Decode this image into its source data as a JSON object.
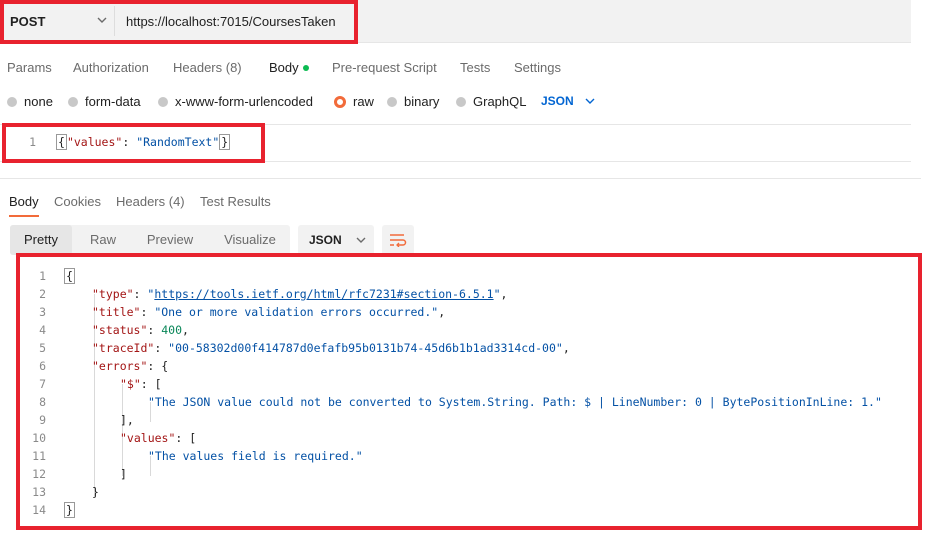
{
  "request": {
    "method": "POST",
    "url": "https://localhost:7015/CoursesTaken"
  },
  "request_tabs": [
    {
      "label": "Params"
    },
    {
      "label": "Authorization"
    },
    {
      "label": "Headers (8)"
    },
    {
      "label": "Body"
    },
    {
      "label": "Pre-request Script"
    },
    {
      "label": "Tests"
    },
    {
      "label": "Settings"
    }
  ],
  "body_types": [
    {
      "label": "none"
    },
    {
      "label": "form-data"
    },
    {
      "label": "x-www-form-urlencoded"
    },
    {
      "label": "raw",
      "selected": true
    },
    {
      "label": "binary"
    },
    {
      "label": "GraphQL"
    }
  ],
  "body_language": "JSON",
  "request_body": {
    "line_number": "1",
    "key": "\"values\"",
    "colon": ": ",
    "value": "\"RandomText\""
  },
  "response_tabs": [
    {
      "label": "Body"
    },
    {
      "label": "Cookies"
    },
    {
      "label": "Headers (4)"
    },
    {
      "label": "Test Results"
    }
  ],
  "view_modes": [
    {
      "label": "Pretty"
    },
    {
      "label": "Raw"
    },
    {
      "label": "Preview"
    },
    {
      "label": "Visualize"
    }
  ],
  "response_format": "JSON",
  "response_lines": [
    {
      "n": "1",
      "indent": 0,
      "parts": [
        [
          "p",
          "{"
        ]
      ]
    },
    {
      "n": "2",
      "indent": 1,
      "parts": [
        [
          "k",
          "\"type\""
        ],
        [
          "p",
          ": "
        ],
        [
          "q",
          "\""
        ],
        [
          "l",
          "https://tools.ietf.org/html/rfc7231#section-6.5.1"
        ],
        [
          "q",
          "\""
        ],
        [
          "p",
          ","
        ]
      ]
    },
    {
      "n": "3",
      "indent": 1,
      "parts": [
        [
          "k",
          "\"title\""
        ],
        [
          "p",
          ": "
        ],
        [
          "s",
          "\"One or more validation errors occurred.\""
        ],
        [
          "p",
          ","
        ]
      ]
    },
    {
      "n": "4",
      "indent": 1,
      "parts": [
        [
          "k",
          "\"status\""
        ],
        [
          "p",
          ": "
        ],
        [
          "n",
          "400"
        ],
        [
          "p",
          ","
        ]
      ]
    },
    {
      "n": "5",
      "indent": 1,
      "parts": [
        [
          "k",
          "\"traceId\""
        ],
        [
          "p",
          ": "
        ],
        [
          "s",
          "\"00-58302d00f414787d0efafb95b0131b74-45d6b1b1ad3314cd-00\""
        ],
        [
          "p",
          ","
        ]
      ]
    },
    {
      "n": "6",
      "indent": 1,
      "parts": [
        [
          "k",
          "\"errors\""
        ],
        [
          "p",
          ": {"
        ]
      ]
    },
    {
      "n": "7",
      "indent": 2,
      "parts": [
        [
          "k",
          "\"$\""
        ],
        [
          "p",
          ": ["
        ]
      ]
    },
    {
      "n": "8",
      "indent": 3,
      "parts": [
        [
          "s",
          "\"The JSON value could not be converted to System.String. Path: $ | LineNumber: 0 | BytePositionInLine: 1.\""
        ]
      ]
    },
    {
      "n": "9",
      "indent": 2,
      "parts": [
        [
          "p",
          "],"
        ]
      ]
    },
    {
      "n": "10",
      "indent": 2,
      "parts": [
        [
          "k",
          "\"values\""
        ],
        [
          "p",
          ": ["
        ]
      ]
    },
    {
      "n": "11",
      "indent": 3,
      "parts": [
        [
          "s",
          "\"The values field is required.\""
        ]
      ]
    },
    {
      "n": "12",
      "indent": 2,
      "parts": [
        [
          "p",
          "]"
        ]
      ]
    },
    {
      "n": "13",
      "indent": 1,
      "parts": [
        [
          "p",
          "}"
        ]
      ]
    },
    {
      "n": "14",
      "indent": 0,
      "parts": [
        [
          "p",
          "}"
        ]
      ]
    }
  ],
  "colors": {
    "highlight_red": "#e8222e",
    "accent_orange": "#f26b3a",
    "active_green": "#0cbb52",
    "link_blue": "#0265d2"
  }
}
